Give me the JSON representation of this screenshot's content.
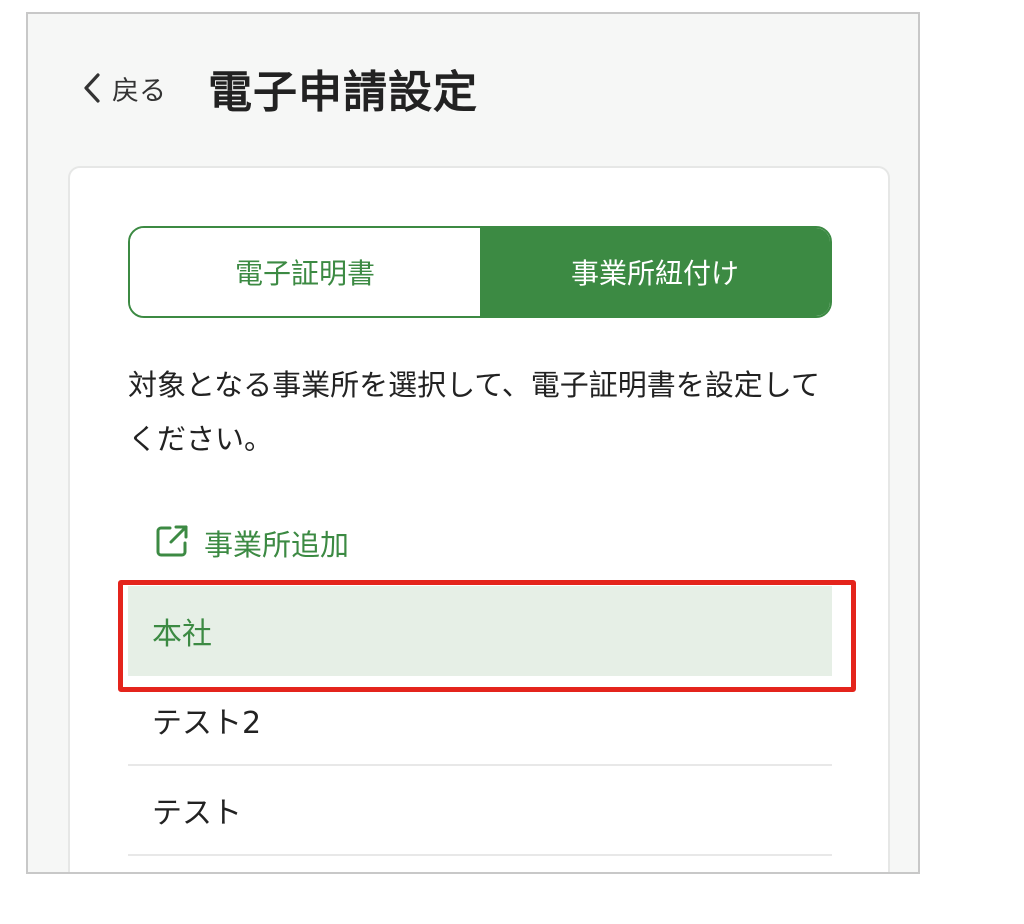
{
  "header": {
    "back_label": "戻る",
    "title": "電子申請設定"
  },
  "tabs": [
    {
      "label": "電子証明書",
      "active": false
    },
    {
      "label": "事業所紐付け",
      "active": true
    }
  ],
  "instruction": "対象となる事業所を選択して、電子証明書を設定してください。",
  "add_office": {
    "label": "事業所追加",
    "icon": "external-link-icon"
  },
  "offices": [
    {
      "label": "本社",
      "selected": true
    },
    {
      "label": "テスト2",
      "selected": false
    },
    {
      "label": "テスト",
      "selected": false
    }
  ],
  "colors": {
    "accent": "#3c8a43",
    "selected_bg": "#e6efe6",
    "highlight": "#e4241c"
  }
}
